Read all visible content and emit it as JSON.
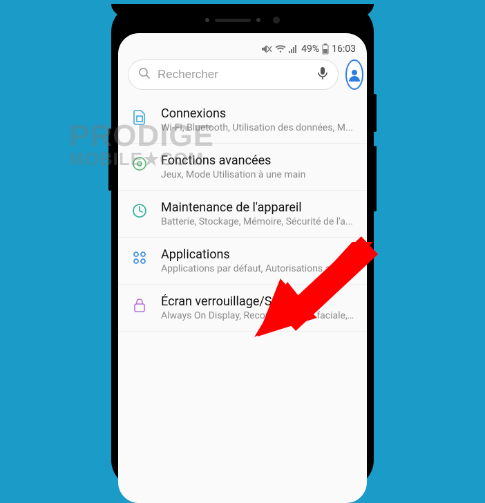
{
  "status": {
    "battery_pct": "49%",
    "time": "16:03"
  },
  "search": {
    "placeholder": "Rechercher"
  },
  "settings": [
    {
      "id": "connexions",
      "title": "Connexions",
      "sub": "Wi-Fi, Bluetooth, Utilisation des données, M..."
    },
    {
      "id": "fonctions",
      "title": "Fonctions avancées",
      "sub": "Jeux, Mode Utilisation à une main"
    },
    {
      "id": "maintenance",
      "title": "Maintenance de l'appareil",
      "sub": "Batterie, Stockage, Mémoire, Sécurité de l'a..."
    },
    {
      "id": "applications",
      "title": "Applications",
      "sub": "Applications par défaut, Autorisations appli..."
    },
    {
      "id": "ecran",
      "title": "Écran verrouillage/Sécurité",
      "sub": "Always On Display, Reconnaissance faciale,..."
    }
  ],
  "watermark": {
    "line1": "PRODIGE",
    "line2": "MOBILE★COM"
  },
  "colors": {
    "background": "#1b9bc7",
    "accent": "#2f7de1",
    "arrow": "#ff0000"
  }
}
